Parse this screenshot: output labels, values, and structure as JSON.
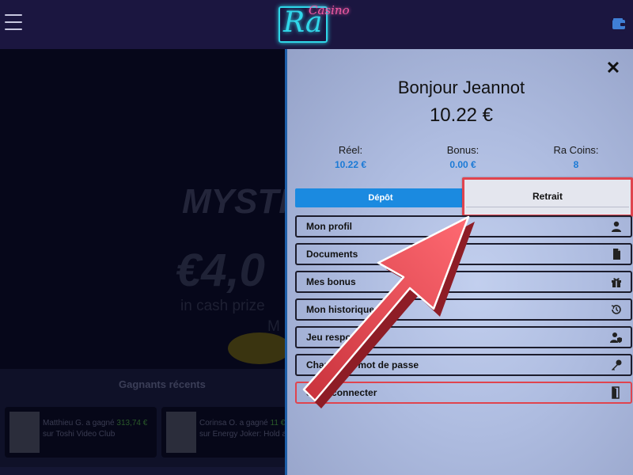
{
  "header": {
    "logo_text": "Ra",
    "logo_sub": "Casino",
    "menu_icon": "hamburger-icon",
    "wallet_icon": "wallet-icon"
  },
  "background": {
    "promo_title": "MYSTI",
    "promo_amount": "€4,0",
    "promo_sub": "in cash prize",
    "promo_sub2": "M",
    "winners_title": "Gagnants récents",
    "winners": [
      {
        "name": "Matthieu G. a gagné",
        "amount": "313,74 €",
        "game": "sur Toshi Video Club"
      },
      {
        "name": "Corinsa O. a gagné",
        "amount": "11 €",
        "game": "sur Energy Joker: Hold an"
      }
    ]
  },
  "panel": {
    "greeting": "Bonjour Jeannot",
    "balance": "10.22 €",
    "stats": [
      {
        "label": "Réel:",
        "value": "10.22 €"
      },
      {
        "label": "Bonus:",
        "value": "0.00 €"
      },
      {
        "label": "Ra Coins:",
        "value": "8"
      }
    ],
    "tabs": {
      "depot": "Dépôt",
      "retrait": "Retrait"
    },
    "menu": [
      {
        "label": "Mon profil",
        "icon": "user-icon"
      },
      {
        "label": "Documents",
        "icon": "document-icon"
      },
      {
        "label": "Mes bonus",
        "icon": "gift-icon"
      },
      {
        "label": "Mon historique",
        "icon": "history-icon"
      },
      {
        "label": "Jeu responsable",
        "icon": "user-shield-icon"
      },
      {
        "label": "Changer le mot de passe",
        "icon": "key-icon"
      },
      {
        "label": "Se déconnecter",
        "icon": "logout-door-icon"
      }
    ]
  },
  "colors": {
    "accent_blue": "#1b8ae0",
    "highlight_red": "#e0444e",
    "value_blue": "#1b7ad6"
  }
}
